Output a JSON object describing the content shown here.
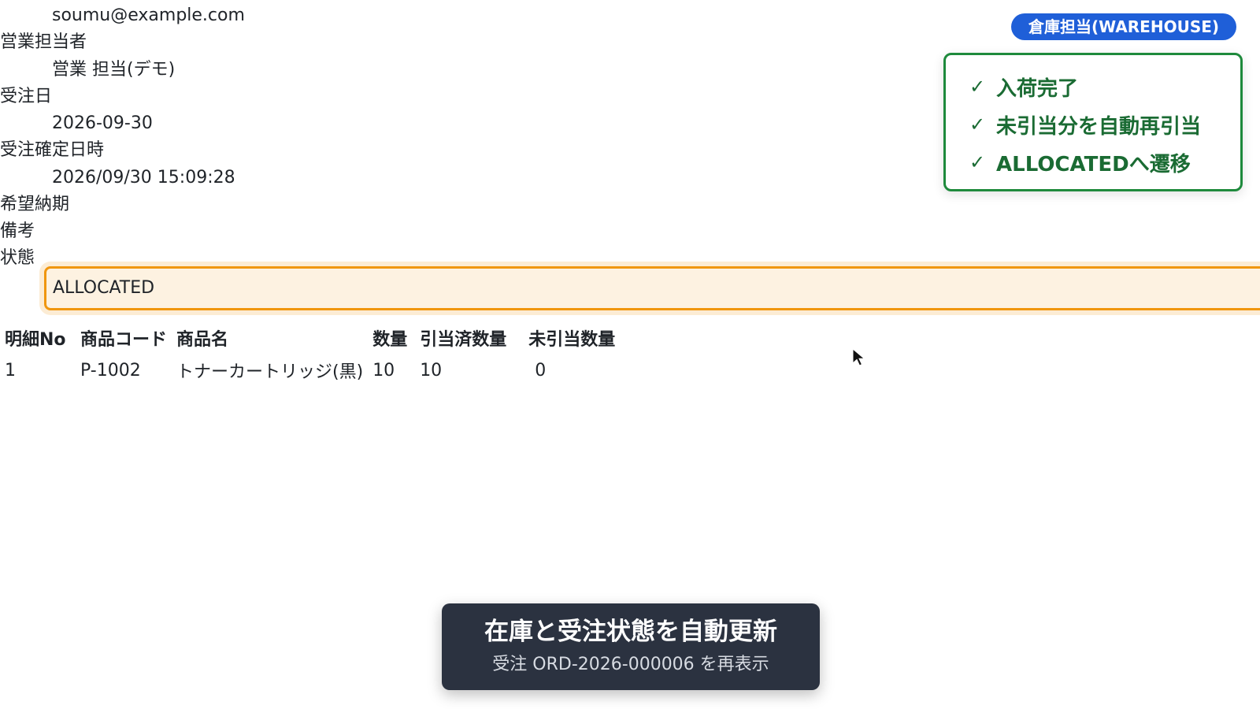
{
  "detail": {
    "email": "soumu@example.com",
    "sales_rep_label": "営業担当者",
    "sales_rep_value": "営業 担当(デモ)",
    "order_date_label": "受注日",
    "order_date_value": "2026-09-30",
    "confirmed_at_label": "受注確定日時",
    "confirmed_at_value": "2026/09/30 15:09:28",
    "desired_delivery_label": "希望納期",
    "remarks_label": "備考",
    "status_label": "状態",
    "status_value": "ALLOCATED"
  },
  "lines_table": {
    "headers": [
      "明細No",
      "商品コード",
      "商品名",
      "数量",
      "引当済数量",
      "未引当数量"
    ],
    "rows": [
      [
        "1",
        "P-1002",
        "トナーカートリッジ(黒)",
        "10",
        "10",
        "0"
      ]
    ]
  },
  "role_badge": {
    "label": "倉庫担当(WAREHOUSE)",
    "color": "#1f5fd8"
  },
  "checklist": {
    "color": "#1e8a3c",
    "items": [
      "入荷完了",
      "未引当分を自動再引当",
      "ALLOCATEDへ遷移"
    ]
  },
  "toast": {
    "title": "在庫と受注状態を自動更新",
    "subtitle": "受注 ORD-2026-000006 を再表示"
  },
  "highlight_color": "#f0960e"
}
